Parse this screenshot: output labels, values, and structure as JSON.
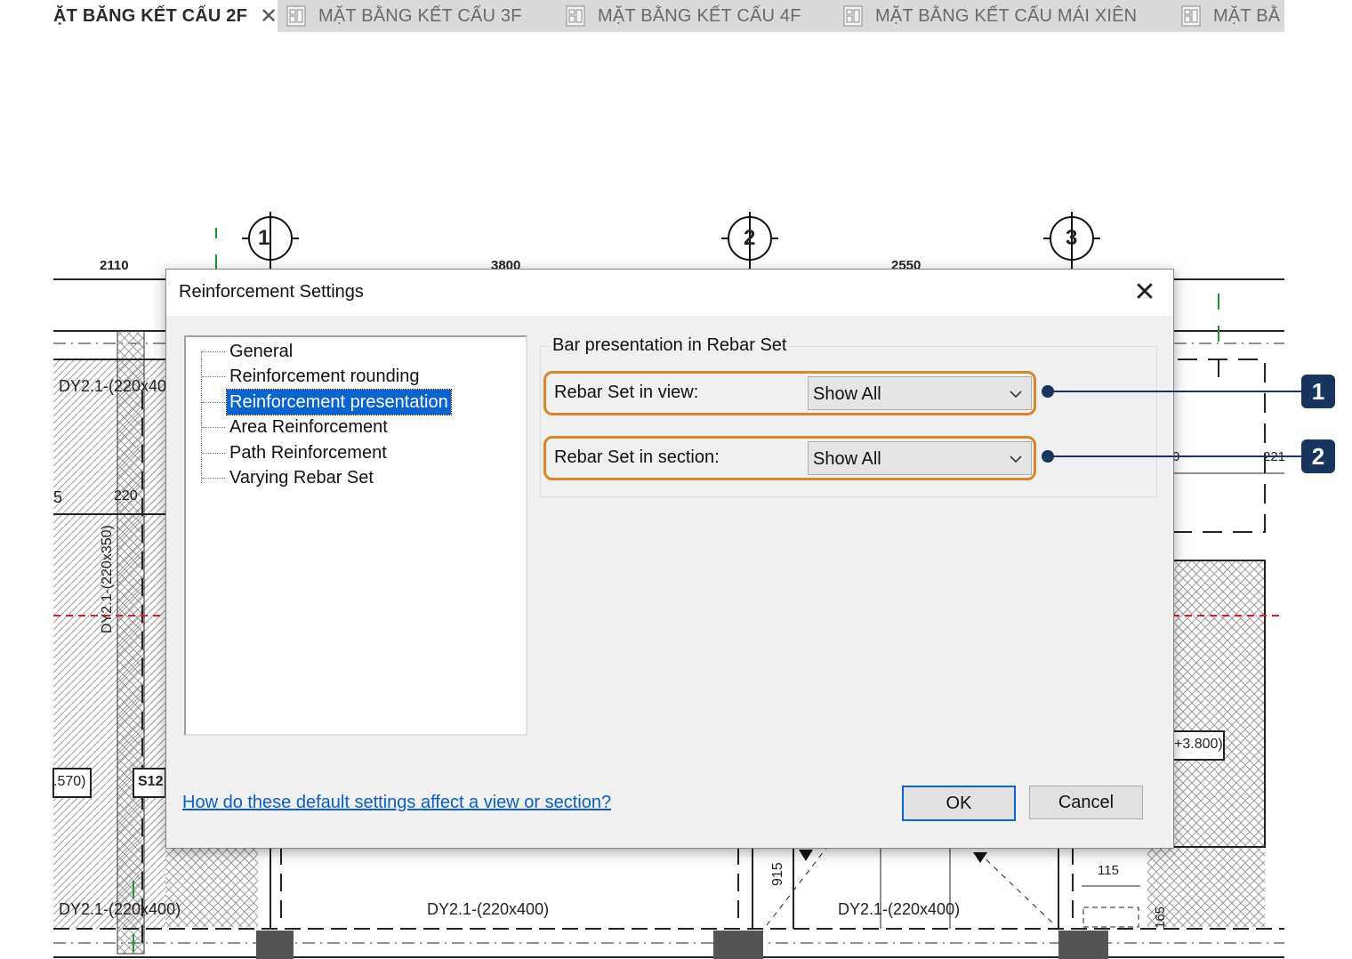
{
  "tabs": [
    {
      "label": "ẶT BĂNG KẾT CẤU 2F",
      "active": true
    },
    {
      "label": "MẶT BẰNG KẾT CẤU 3F",
      "active": false
    },
    {
      "label": "MẶT BẰNG KẾT CẤU 4F",
      "active": false
    },
    {
      "label": "MẶT BẰNG KẾT CẤU MÁI XIÊN",
      "active": false
    },
    {
      "label": "MẶT BẰ",
      "active": false
    }
  ],
  "drawing": {
    "grid_bubbles": [
      "1",
      "2",
      "3"
    ],
    "dimensions": [
      "2110",
      "3800",
      "2550"
    ],
    "labels": {
      "beam_top_left": "DY2.1-(220x40",
      "beam_vertical": "DY2.1-(220x350)",
      "beam_bottom_left": "DY2.1-(220x400)",
      "beam_bottom_mid": "DY2.1-(220x400)",
      "beam_bottom_right": "DY2.1-(220x400)",
      "level_left": ".570)",
      "slab_tag": "S12",
      "level_right": "+3.800)",
      "dim_220": "220",
      "dim_5": "5",
      "dim_915": "915",
      "dim_115": "115",
      "dim_165": "165",
      "dim_0": "0",
      "dim_221": "221"
    }
  },
  "dialog": {
    "title": "Reinforcement Settings",
    "tree_items": [
      "General",
      "Reinforcement rounding",
      "Reinforcement presentation",
      "Area Reinforcement",
      "Path Reinforcement",
      "Varying Rebar Set"
    ],
    "selected_index": 2,
    "group_title": "Bar presentation in Rebar Set",
    "options": [
      {
        "label": "Rebar Set in view:",
        "value": "Show All"
      },
      {
        "label": "Rebar Set in section:",
        "value": "Show All"
      }
    ],
    "help_link": "How do these default settings affect a view or section?",
    "ok_label": "OK",
    "cancel_label": "Cancel"
  },
  "callouts": [
    "1",
    "2"
  ],
  "colors": {
    "highlight_outline": "#d8862c",
    "callout": "#17355f",
    "selection": "#0a64d0",
    "link": "#0b5fc6"
  }
}
